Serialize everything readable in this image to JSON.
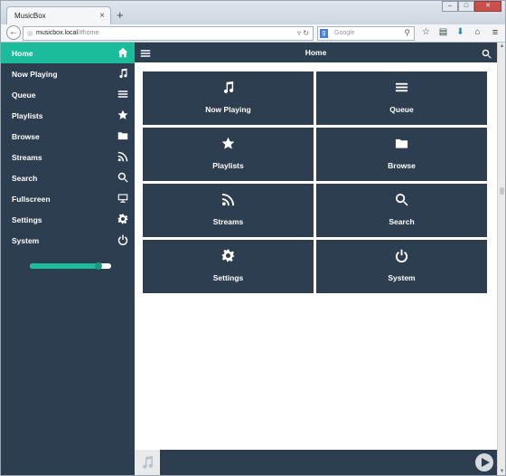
{
  "browser": {
    "tab_title": "MusicBox",
    "tab_close": "×",
    "new_tab": "+",
    "url_host": "musicbox.local",
    "url_path": "/#home",
    "search_placeholder": "Google",
    "search_engine_letter": "g",
    "window_buttons": [
      "–",
      "□",
      "✕"
    ]
  },
  "sidebar": {
    "items": [
      {
        "label": "Home",
        "icon": "home-icon",
        "active": true
      },
      {
        "label": "Now Playing",
        "icon": "music-icon"
      },
      {
        "label": "Queue",
        "icon": "list-icon"
      },
      {
        "label": "Playlists",
        "icon": "star-icon"
      },
      {
        "label": "Browse",
        "icon": "folder-icon"
      },
      {
        "label": "Streams",
        "icon": "rss-icon"
      },
      {
        "label": "Search",
        "icon": "search-icon"
      },
      {
        "label": "Fullscreen",
        "icon": "monitor-icon"
      },
      {
        "label": "Settings",
        "icon": "gear-icon"
      },
      {
        "label": "System",
        "icon": "power-icon"
      }
    ],
    "volume_level": 0.84
  },
  "header": {
    "title": "Home"
  },
  "tiles": [
    {
      "label": "Now Playing",
      "icon": "music-icon"
    },
    {
      "label": "Queue",
      "icon": "list-icon"
    },
    {
      "label": "Playlists",
      "icon": "star-icon"
    },
    {
      "label": "Browse",
      "icon": "folder-icon"
    },
    {
      "label": "Streams",
      "icon": "rss-icon"
    },
    {
      "label": "Search",
      "icon": "search-icon"
    },
    {
      "label": "Settings",
      "icon": "gear-icon"
    },
    {
      "label": "System",
      "icon": "power-icon"
    }
  ],
  "colors": {
    "accent": "#1abc9c",
    "panel": "#2c3e50"
  }
}
